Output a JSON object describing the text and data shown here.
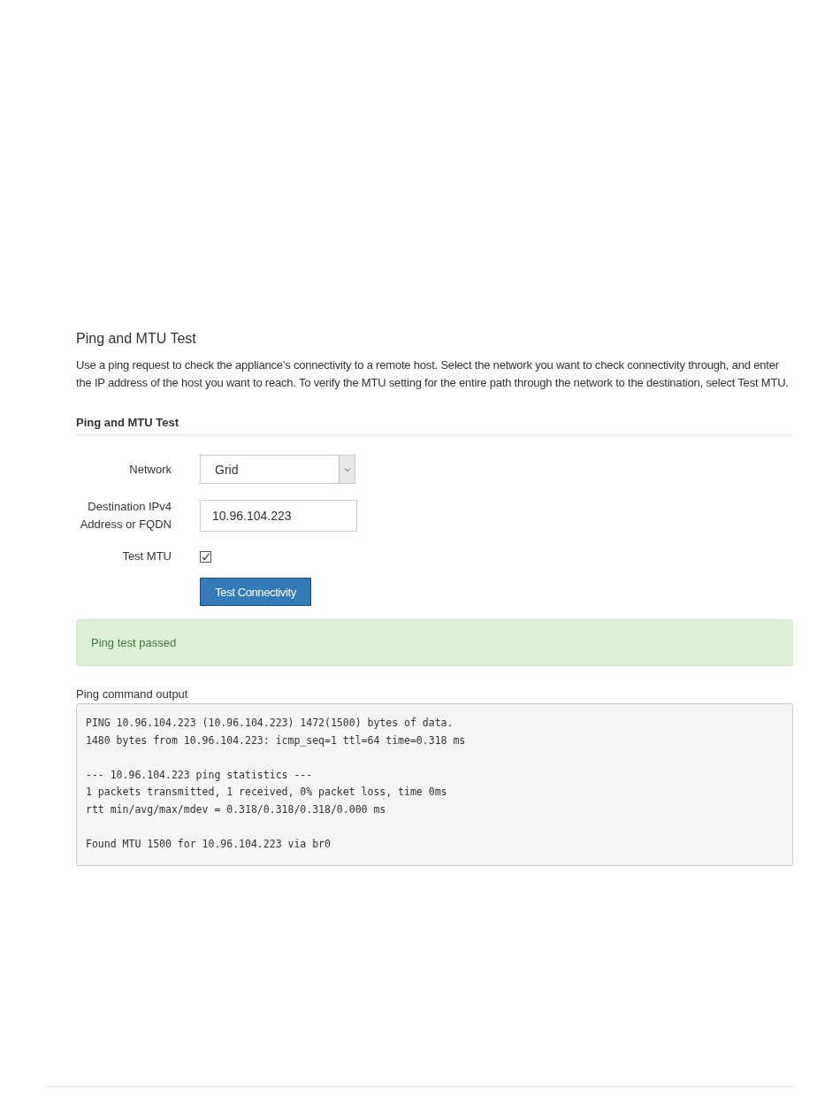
{
  "page_title": "Ping and MTU Test",
  "description": "Use a ping request to check the appliance's connectivity to a remote host. Select the network you want to check connectivity through, and enter the IP address of the host you want to reach. To verify the MTU setting for the entire path through the network to the destination, select Test MTU.",
  "section_title": "Ping and MTU Test",
  "form": {
    "network": {
      "label": "Network",
      "value": "Grid"
    },
    "destination": {
      "label": "Destination IPv4 Address or FQDN",
      "value": "10.96.104.223"
    },
    "test_mtu": {
      "label": "Test MTU",
      "checked": true
    },
    "button": "Test Connectivity"
  },
  "alert": {
    "kind": "success",
    "text": "Ping test passed"
  },
  "output": {
    "label": "Ping command output",
    "paragraphs": [
      [
        "PING 10.96.104.223 (10.96.104.223) 1472(1500) bytes of data.",
        "1480 bytes from 10.96.104.223: icmp_seq=1 ttl=64 time=0.318 ms"
      ],
      [
        "--- 10.96.104.223 ping statistics ---",
        "1 packets transmitted, 1 received, 0% packet loss, time 0ms",
        "rtt min/avg/max/mdev = 0.318/0.318/0.318/0.000 ms"
      ],
      [
        "Found MTU 1500 for 10.96.104.223 via br0"
      ]
    ]
  }
}
